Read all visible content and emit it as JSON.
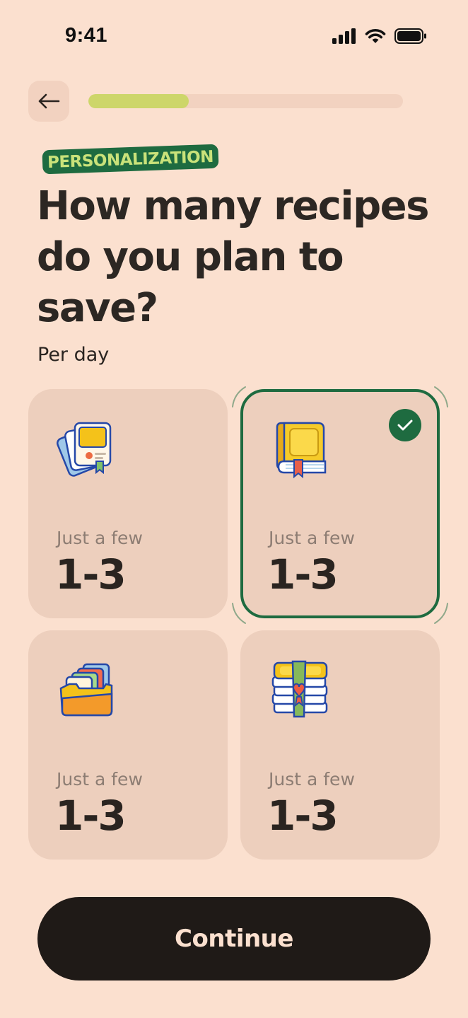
{
  "status_bar": {
    "time": "9:41",
    "icons": [
      "cellular-signal-icon",
      "wifi-icon",
      "battery-icon"
    ]
  },
  "header": {
    "back_icon": "arrow-left-icon",
    "progress_fraction": 0.32
  },
  "tag": "PERSONALIZATION",
  "title": "How many recipes do you plan to save?",
  "subtitle": "Per day",
  "options": [
    {
      "icon": "recipe-cards-icon",
      "label": "Just a few",
      "value": "1-3",
      "selected": false
    },
    {
      "icon": "cookbook-icon",
      "label": "Just a few",
      "value": "1-3",
      "selected": true
    },
    {
      "icon": "recipe-box-icon",
      "label": "Just a few",
      "value": "1-3",
      "selected": false
    },
    {
      "icon": "recipe-stack-icon",
      "label": "Just a few",
      "value": "1-3",
      "selected": false
    }
  ],
  "continue_label": "Continue",
  "colors": {
    "background": "#fbe0cf",
    "card": "#edcfbd",
    "accent_green": "#1e6b40",
    "progress": "#cdd66a",
    "button": "#1f1a17"
  }
}
